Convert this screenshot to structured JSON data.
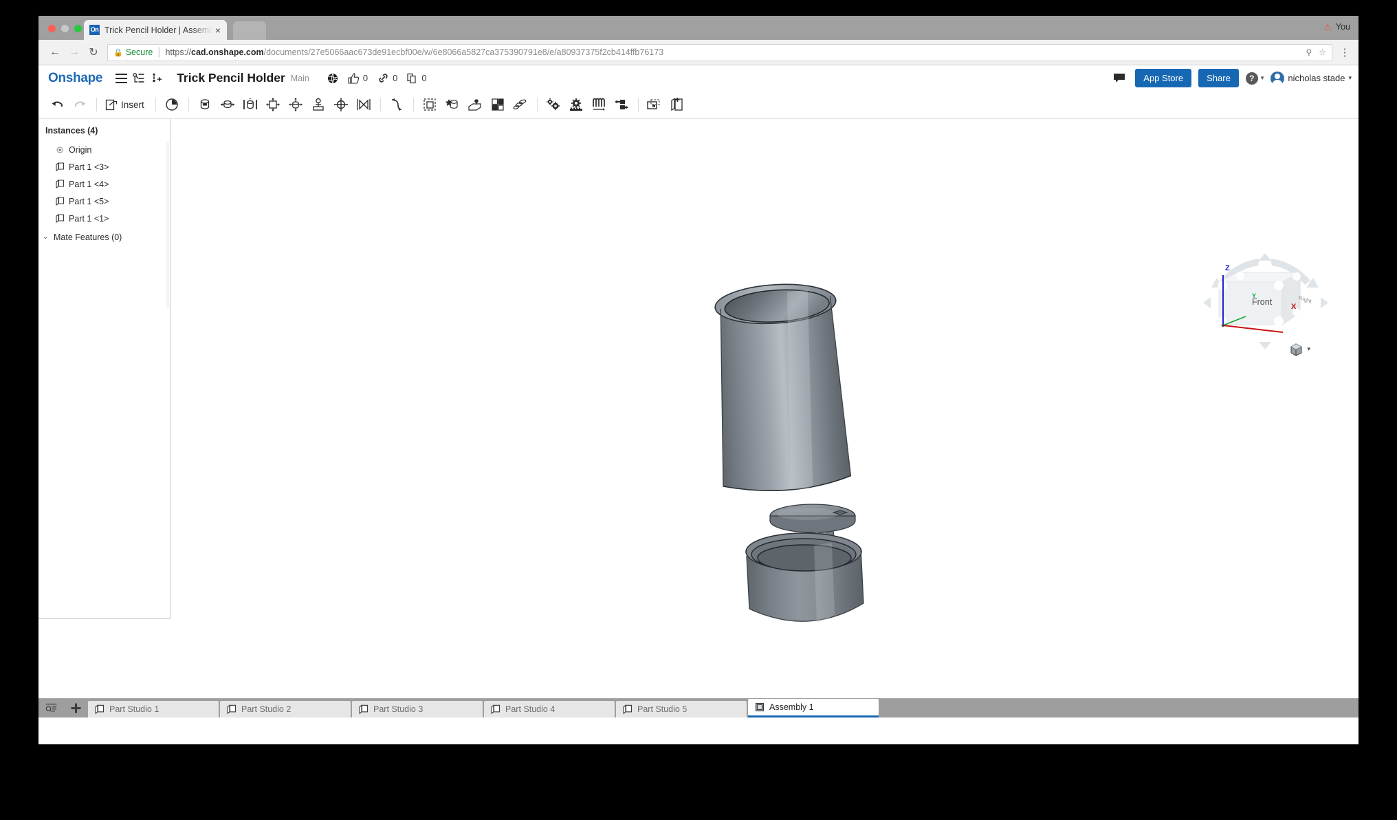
{
  "browser": {
    "tab": {
      "favicon_text": "On",
      "title": "Trick Pencil Holder | Assembly",
      "close_label": "×"
    },
    "profile_label": "You",
    "nav": {
      "back": "←",
      "forward": "→",
      "reload": "↻",
      "menu": "⋮"
    },
    "omnibox": {
      "secure_label": "Secure",
      "url_scheme": "https://",
      "url_domain": "cad.onshape.com",
      "url_path": "/documents/27e5066aac673de91ecbf00e/w/6e8066a5827ca375390791e8/e/a80937375f2cb414ffb76173",
      "full_url": "https://cad.onshape.com/documents/27e5066aac673de91ecbf00e/w/6e8066a5827ca375390791e8/e/a80937375f2cb414ffb76173"
    }
  },
  "app_header": {
    "brand": "Onshape",
    "document_title": "Trick Pencil Holder",
    "branch": "Main",
    "stats": {
      "like_count": "0",
      "link_count": "0",
      "copy_count": "0"
    },
    "app_store_label": "App Store",
    "share_label": "Share",
    "help_label": "?",
    "username": "nicholas stade",
    "caret": "▾"
  },
  "toolbar": {
    "insert_label": "Insert",
    "items": [
      {
        "name": "undo",
        "glyph": "↶"
      },
      {
        "name": "redo",
        "glyph": "↷"
      },
      {
        "name": "insert",
        "glyph": "⬆"
      },
      {
        "name": "replicate-history",
        "glyph": "◴"
      },
      {
        "name": "fastened-mate",
        "glyph": "◓"
      },
      {
        "name": "revolute-mate",
        "glyph": "◑"
      },
      {
        "name": "slider-mate",
        "glyph": "▤"
      },
      {
        "name": "planar-mate",
        "glyph": "✛"
      },
      {
        "name": "cylindrical-mate",
        "glyph": "✣"
      },
      {
        "name": "pin-slot-mate",
        "glyph": "⚘"
      },
      {
        "name": "ball-mate",
        "glyph": "⊕"
      },
      {
        "name": "parallel-mate",
        "glyph": "⋈"
      },
      {
        "name": "tangent-mate",
        "glyph": "⤳"
      },
      {
        "name": "group",
        "glyph": "⧉"
      },
      {
        "name": "mate-connector",
        "glyph": "★"
      },
      {
        "name": "replicate",
        "glyph": "⌗"
      },
      {
        "name": "explode",
        "glyph": "◫"
      },
      {
        "name": "relations",
        "glyph": "⚙"
      },
      {
        "name": "gear-relation",
        "glyph": "⚙"
      },
      {
        "name": "linear-relation",
        "glyph": "☸"
      },
      {
        "name": "screw-relation",
        "glyph": "⚙"
      },
      {
        "name": "tangent-relation",
        "glyph": "∴"
      },
      {
        "name": "assembly-feature",
        "glyph": "▣"
      },
      {
        "name": "insert-part",
        "glyph": "⧉"
      }
    ]
  },
  "instances_panel": {
    "title": "Instances (4)",
    "items": [
      {
        "label": "Origin",
        "icon": "origin-icon"
      },
      {
        "label": "Part 1 <3>",
        "icon": "part-icon"
      },
      {
        "label": "Part 1 <4>",
        "icon": "part-icon"
      },
      {
        "label": "Part 1 <5>",
        "icon": "part-icon"
      },
      {
        "label": "Part 1 <1>",
        "icon": "part-icon"
      }
    ],
    "mate_features_label": "Mate Features (0)",
    "chevron": "⌄"
  },
  "viewcube": {
    "front_label": "Front",
    "right_label": "Right",
    "axis_z": "Z",
    "axis_y": "Y",
    "axis_x": "X",
    "axis_z_color": "#2222cc",
    "axis_y_color": "#11aa33",
    "axis_x_color": "#cc1111",
    "display_mode_caret": "▾"
  },
  "doc_tabs": {
    "filter_icon": "tab-filter-icon",
    "add_label": "+",
    "tabs": [
      {
        "label": "Part Studio 1",
        "active": false
      },
      {
        "label": "Part Studio 2",
        "active": false
      },
      {
        "label": "Part Studio 3",
        "active": false
      },
      {
        "label": "Part Studio 4",
        "active": false
      },
      {
        "label": "Part Studio 5",
        "active": false
      },
      {
        "label": "Assembly 1",
        "active": true
      }
    ]
  },
  "colors": {
    "brand_blue": "#1d6ab5",
    "button_blue": "#1668b3",
    "secure_green": "#0f8a35",
    "model_gray": "#7f868c",
    "canvas_white": "#ffffff"
  }
}
